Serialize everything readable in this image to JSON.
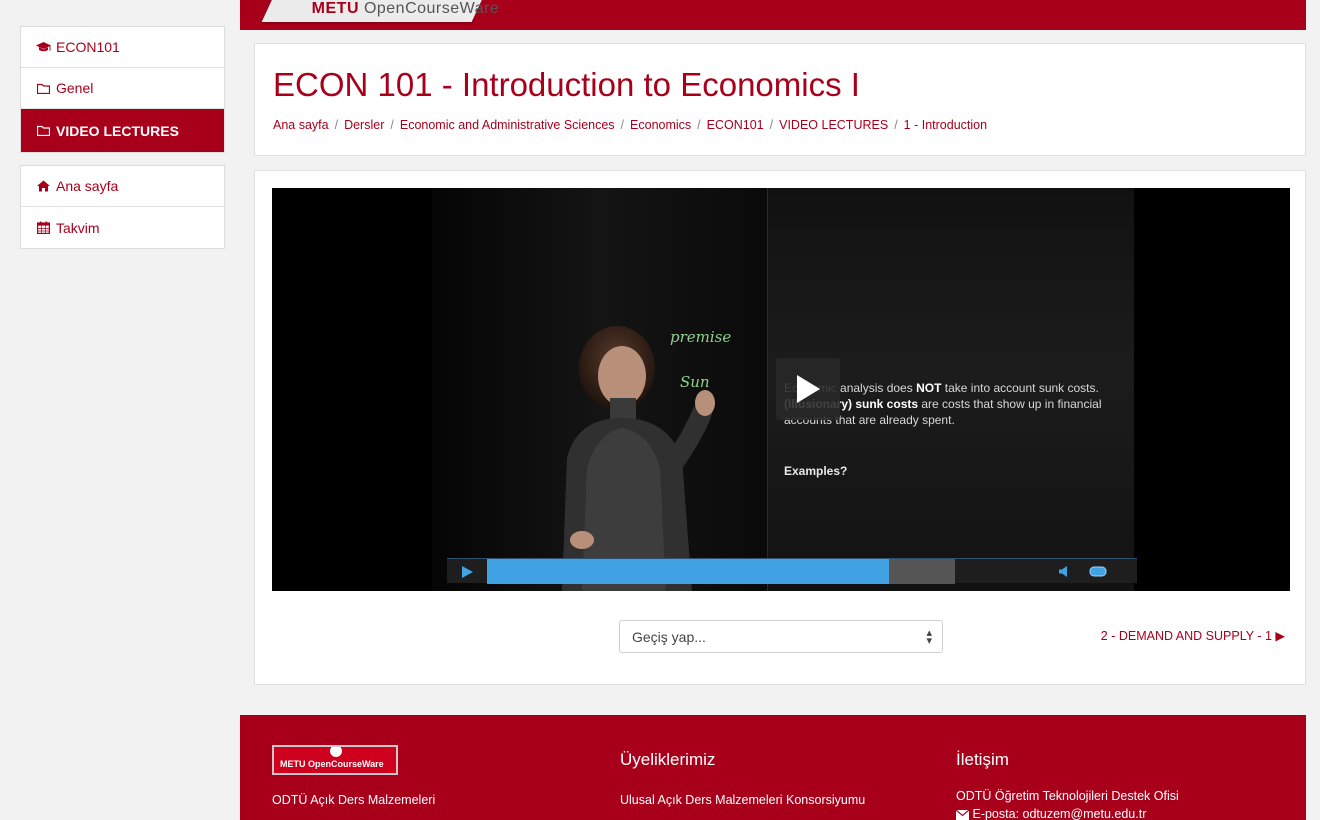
{
  "topbar": {
    "logo_text_strong": "METU",
    "logo_text": " OpenCourseWare"
  },
  "sidebar": {
    "course_items": [
      {
        "label": "ECON101",
        "icon": "graduation-cap-icon"
      },
      {
        "label": "Genel",
        "icon": "folder-icon"
      },
      {
        "label": "VIDEO LECTURES",
        "icon": "folder-icon",
        "active": true
      }
    ],
    "nav_items": [
      {
        "label": "Ana sayfa",
        "icon": "home-icon"
      },
      {
        "label": "Takvim",
        "icon": "calendar-icon"
      }
    ]
  },
  "header": {
    "title": "ECON 101 - Introduction to Economics I",
    "breadcrumb": [
      "Ana sayfa",
      "Dersler",
      "Economic and Administrative Sciences",
      "Economics",
      "ECON101",
      "VIDEO LECTURES",
      "1 - Introduction"
    ],
    "separator": "/"
  },
  "video": {
    "handwriting_1": "premise",
    "handwriting_2": "Sun",
    "slide_pre": "Economic analysis does ",
    "slide_not": "NOT",
    "slide_mid": " take into account sunk costs. ",
    "slide_bold": "(Illusionary) sunk costs",
    "slide_post": " are costs that show up in financial accounts that are already spent.",
    "slide_examples": "Examples?",
    "progress_fraction": 0.86,
    "buffered_fraction": 1.0
  },
  "navigation": {
    "jump_placeholder": "Geçiş yap...",
    "next_label": "2 - DEMAND AND SUPPLY - 1 ▶"
  },
  "footer": {
    "logo_text": "METU OpenCourseWare",
    "col1_text": "ODTÜ Açık Ders Malzemeleri",
    "col2_heading": "Üyeliklerimiz",
    "col2_text": "Ulusal Açık Ders Malzemeleri Konsorsiyumu",
    "col3_heading": "İletişim",
    "col3_text": "ODTÜ Öğretim Teknolojileri Destek Ofisi",
    "col3_email": "E-posta: odtuzem@metu.edu.tr"
  },
  "colors": {
    "brand": "#a8001b",
    "progress": "#41a3e4"
  }
}
